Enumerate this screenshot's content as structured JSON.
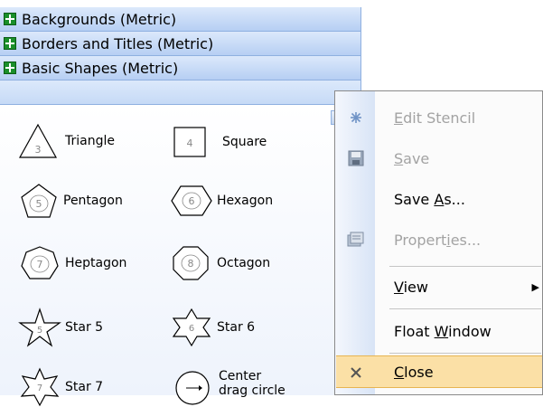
{
  "stencils": [
    {
      "title": "Backgrounds (Metric)",
      "icon": "stencil-icon"
    },
    {
      "title": "Borders and Titles (Metric)",
      "icon": "stencil-icon"
    },
    {
      "title": "Basic Shapes (Metric)",
      "icon": "stencil-icon"
    }
  ],
  "shapes": [
    {
      "label": "Triangle",
      "glyph": "3",
      "icon": "triangle-shape-icon"
    },
    {
      "label": "Square",
      "glyph": "4",
      "icon": "square-shape-icon"
    },
    {
      "label": "Pentagon",
      "glyph": "5",
      "icon": "pentagon-shape-icon"
    },
    {
      "label": "Hexagon",
      "glyph": "6",
      "icon": "hexagon-shape-icon"
    },
    {
      "label": "Heptagon",
      "glyph": "7",
      "icon": "heptagon-shape-icon"
    },
    {
      "label": "Octagon",
      "glyph": "8",
      "icon": "octagon-shape-icon"
    },
    {
      "label": "Star 5",
      "glyph": "5",
      "icon": "star5-shape-icon"
    },
    {
      "label": "Star 6",
      "glyph": "6",
      "icon": "star6-shape-icon"
    },
    {
      "label": "Star 7",
      "glyph": "7",
      "icon": "star7-shape-icon"
    },
    {
      "label": "Center drag circle",
      "line1": "Center",
      "line2": "drag circle",
      "icon": "center-drag-circle-shape-icon"
    }
  ],
  "menu": {
    "items": [
      {
        "pre": "",
        "accel": "E",
        "post": "dit Stencil",
        "disabled": true,
        "icon": "edit-stencil-icon"
      },
      {
        "pre": "",
        "accel": "S",
        "post": "ave",
        "disabled": true,
        "icon": "save-icon"
      },
      {
        "pre": "Save ",
        "accel": "A",
        "post": "s...",
        "disabled": false,
        "icon": ""
      },
      {
        "pre": "Propert",
        "accel": "i",
        "post": "es...",
        "disabled": true,
        "icon": "properties-icon"
      },
      {
        "pre": "",
        "accel": "V",
        "post": "iew",
        "disabled": false,
        "icon": "",
        "submenu": "▶"
      },
      {
        "pre": "Float ",
        "accel": "W",
        "post": "indow",
        "disabled": false,
        "icon": ""
      },
      {
        "pre": "",
        "accel": "C",
        "post": "lose",
        "disabled": false,
        "icon": "close-icon",
        "highlighted": true
      }
    ]
  },
  "colors": {
    "header_gradient_top": "#dce9fb",
    "header_gradient_bottom": "#b6cff3",
    "menu_highlight": "#fbe0a6",
    "disabled_text": "#a3a3a3"
  }
}
